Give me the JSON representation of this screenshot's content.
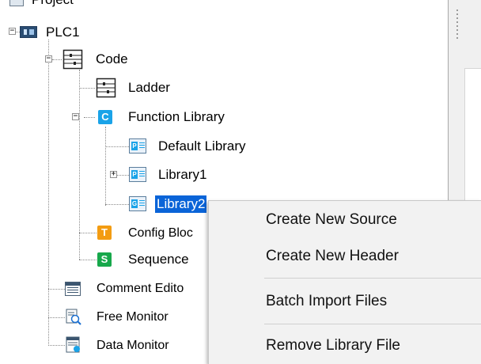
{
  "tree": {
    "project": {
      "label": "Project"
    },
    "plc": {
      "label": "PLC1"
    },
    "code": {
      "label": "Code"
    },
    "ladder": {
      "label": "Ladder"
    },
    "function_library": {
      "label": "Function Library",
      "icon_letter": "C"
    },
    "default_library": {
      "label": "Default Library"
    },
    "library1": {
      "label": "Library1"
    },
    "library2": {
      "label": "Library2"
    },
    "config_block": {
      "label": "Config Bloc",
      "icon_letter": "T"
    },
    "sequence": {
      "label": "Sequence",
      "icon_letter": "S"
    },
    "comment_editor": {
      "label": "Comment Edito"
    },
    "free_monitor": {
      "label": "Free Monitor"
    },
    "data_monitor": {
      "label": "Data Monitor"
    }
  },
  "context_menu": {
    "items": [
      {
        "label": "Create New Source"
      },
      {
        "label": "Create New Header"
      },
      {
        "label": "Batch Import Files"
      },
      {
        "label": "Remove Library File"
      }
    ]
  },
  "colors": {
    "selection": "#0a64d8",
    "c_icon": "#1aa3e8",
    "t_icon": "#f39c12",
    "s_icon": "#17a84b"
  }
}
